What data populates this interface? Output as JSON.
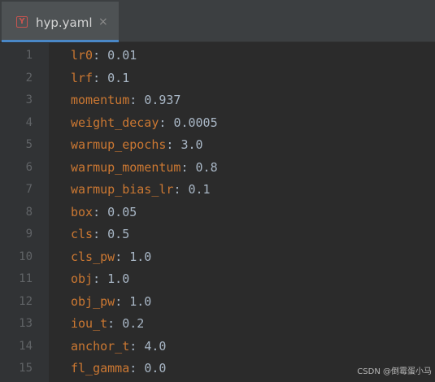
{
  "tab": {
    "icon": "yaml-file-icon",
    "icon_glyph": "Y",
    "title": "hyp.yaml",
    "close": "×"
  },
  "lines": [
    {
      "number": "1",
      "key": "lr0",
      "value": "0.01"
    },
    {
      "number": "2",
      "key": "lrf",
      "value": "0.1"
    },
    {
      "number": "3",
      "key": "momentum",
      "value": "0.937"
    },
    {
      "number": "4",
      "key": "weight_decay",
      "value": "0.0005"
    },
    {
      "number": "5",
      "key": "warmup_epochs",
      "value": "3.0"
    },
    {
      "number": "6",
      "key": "warmup_momentum",
      "value": "0.8"
    },
    {
      "number": "7",
      "key": "warmup_bias_lr",
      "value": "0.1"
    },
    {
      "number": "8",
      "key": "box",
      "value": "0.05"
    },
    {
      "number": "9",
      "key": "cls",
      "value": "0.5"
    },
    {
      "number": "10",
      "key": "cls_pw",
      "value": "1.0"
    },
    {
      "number": "11",
      "key": "obj",
      "value": "1.0"
    },
    {
      "number": "12",
      "key": "obj_pw",
      "value": "1.0"
    },
    {
      "number": "13",
      "key": "iou_t",
      "value": "0.2"
    },
    {
      "number": "14",
      "key": "anchor_t",
      "value": "4.0"
    },
    {
      "number": "15",
      "key": "fl_gamma",
      "value": "0.0"
    }
  ],
  "separator": ": ",
  "watermark": "CSDN @倒霉蛋小马",
  "colors": {
    "key": "#cc7832",
    "value": "#a9b7c6",
    "line_number": "#606366",
    "background": "#2b2b2b",
    "tab_underline": "#4a88c7"
  }
}
